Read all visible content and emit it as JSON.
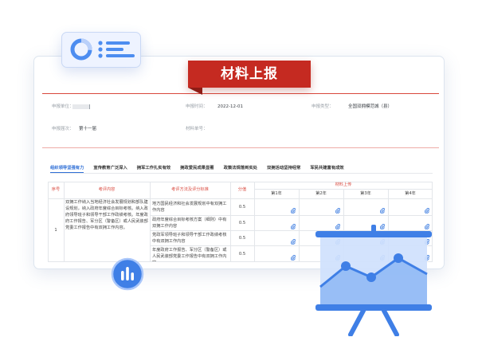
{
  "ribbon": {
    "text": "材料上报"
  },
  "form": {
    "declarant_label": "申报单位：",
    "declare_time_label": "申报时间：",
    "declare_time_value": "2022-12-01",
    "category_label": "申报类型：",
    "category_value": "全国双拥模范城（县）",
    "session_label": "申报届次：",
    "session_value": "第十一届",
    "doc_no_label": "材料单号："
  },
  "tabs": [
    {
      "label": "组织领导坚强有力",
      "active": true
    },
    {
      "label": "宣传教育广泛深入",
      "active": false
    },
    {
      "label": "拥军工作扎实有效",
      "active": false
    },
    {
      "label": "拥政爱民成果显著",
      "active": false
    },
    {
      "label": "政策法规落到实处",
      "active": false
    },
    {
      "label": "双拥活动坚持经常",
      "active": false
    },
    {
      "label": "军民共建富有成效",
      "active": false
    }
  ],
  "table": {
    "headers": {
      "index": "序号",
      "content": "考评内容",
      "method": "考评方法及评分标准",
      "score": "分值",
      "upload": "材料上传"
    },
    "rounds": [
      "第1年",
      "第2年",
      "第3年",
      "第4年"
    ],
    "row_index": "1",
    "row_content": "双拥工作纳入当地经济社会发展规划和部队建设规划，纳入政府年度综合目标考核。纳入政府领导班子和领导干部工作政绩考核。年度政府工作报告、军分区（警备区）或人民武装部党委工作报告中有双拥工作内容。",
    "criteria": [
      {
        "text": "地方国民经济和社会发展规划中有双拥工作内容",
        "score": "0.5"
      },
      {
        "text": "政府年度综合目标考核方案（细则）中有双拥工作内容",
        "score": "0.5"
      },
      {
        "text": "党政军领导班子和领导干部工作政绩考核中有双拥工作内容",
        "score": "0.5"
      },
      {
        "text": "年度政府工作报告、军分区（警备区）或人民武装部党委工作报告中有双拥工作内容",
        "score": "0.5"
      }
    ]
  },
  "colors": {
    "accent_red": "#c52a21",
    "accent_blue": "#2f6fd6",
    "widget_blue": "#4d8df0"
  },
  "icons": {
    "profile": "profile-card-icon",
    "attachment": "paperclip-icon",
    "stats": "bar-stats-icon",
    "presentation": "presentation-board-icon"
  }
}
